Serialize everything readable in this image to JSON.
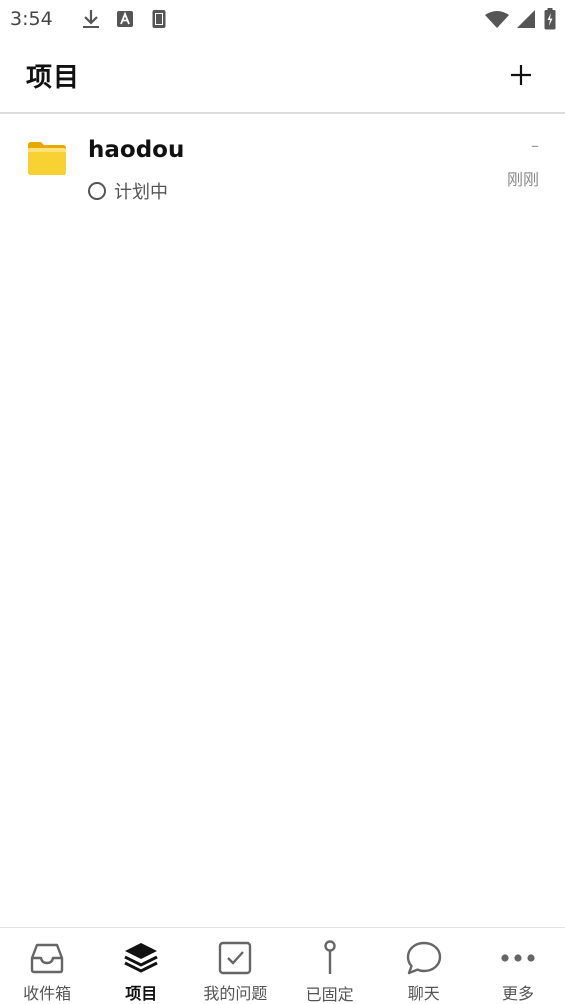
{
  "status_bar": {
    "time": "3:54",
    "icons": [
      "download-icon",
      "font-a-icon",
      "sd-card-icon",
      "wifi-icon",
      "signal-icon",
      "battery-charging-icon"
    ]
  },
  "header": {
    "title": "项目",
    "add_icon": "plus-icon"
  },
  "projects": [
    {
      "name": "haodou",
      "status": "计划中",
      "dash": "–",
      "updated": "刚刚",
      "icon": "folder-icon",
      "icon_color": "#F5C518"
    }
  ],
  "bottom_nav": {
    "items": [
      {
        "label": "收件箱",
        "icon": "inbox-icon",
        "active": false
      },
      {
        "label": "项目",
        "icon": "layers-icon",
        "active": true
      },
      {
        "label": "我的问题",
        "icon": "checkbox-icon",
        "active": false
      },
      {
        "label": "已固定",
        "icon": "pin-icon",
        "active": false
      },
      {
        "label": "聊天",
        "icon": "chat-bubble-icon",
        "active": false
      },
      {
        "label": "更多",
        "icon": "more-dots-icon",
        "active": false
      }
    ]
  }
}
